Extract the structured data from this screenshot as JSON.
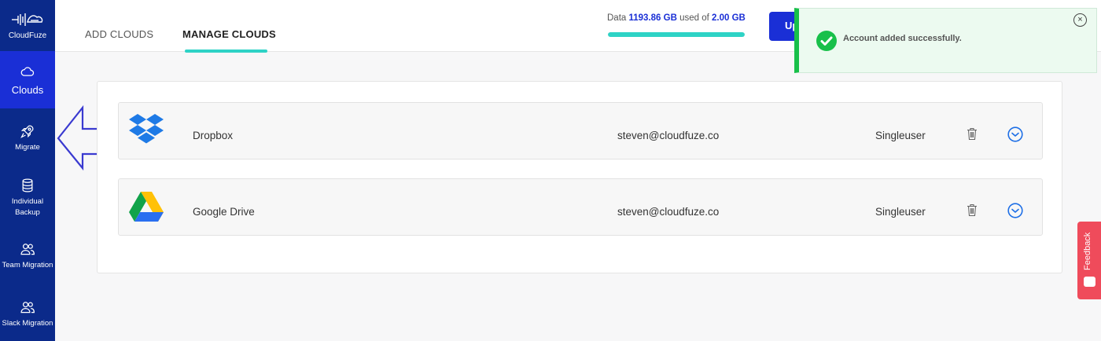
{
  "brand": {
    "name": "CloudFuze"
  },
  "sidebar": {
    "items": [
      {
        "label": "Clouds",
        "icon": "cloud-icon",
        "active": true
      },
      {
        "label": "Migrate",
        "icon": "rocket-icon"
      },
      {
        "label": "Individual Backup",
        "icon": "database-icon"
      },
      {
        "label": "Team Migration",
        "icon": "users-icon"
      },
      {
        "label": "Slack Migration",
        "icon": "users-icon"
      }
    ]
  },
  "header": {
    "tabs": [
      {
        "label": "ADD CLOUDS"
      },
      {
        "label": "MANAGE CLOUDS",
        "active": true
      }
    ],
    "storage": {
      "prefix": "Data",
      "used": "1193.86 GB",
      "middle": "used of",
      "total": "2.00 GB",
      "fill_fraction": 1.0
    },
    "upgrade_label": "Up"
  },
  "toast": {
    "message": "Account added successfully.",
    "close_label": "×"
  },
  "clouds": [
    {
      "name": "Dropbox",
      "email": "steven@cloudfuze.co",
      "type": "Singleuser",
      "icon": "dropbox-icon"
    },
    {
      "name": "Google Drive",
      "email": "steven@cloudfuze.co",
      "type": "Singleuser",
      "icon": "google-drive-icon"
    }
  ],
  "feedback": {
    "label": "Feedback"
  },
  "colors": {
    "sidebar": "#0b2a8a",
    "sidebar_active": "#1a2fd6",
    "accent_teal": "#2ed3c6",
    "success": "#18c04a",
    "feedback": "#ef4b5b"
  }
}
